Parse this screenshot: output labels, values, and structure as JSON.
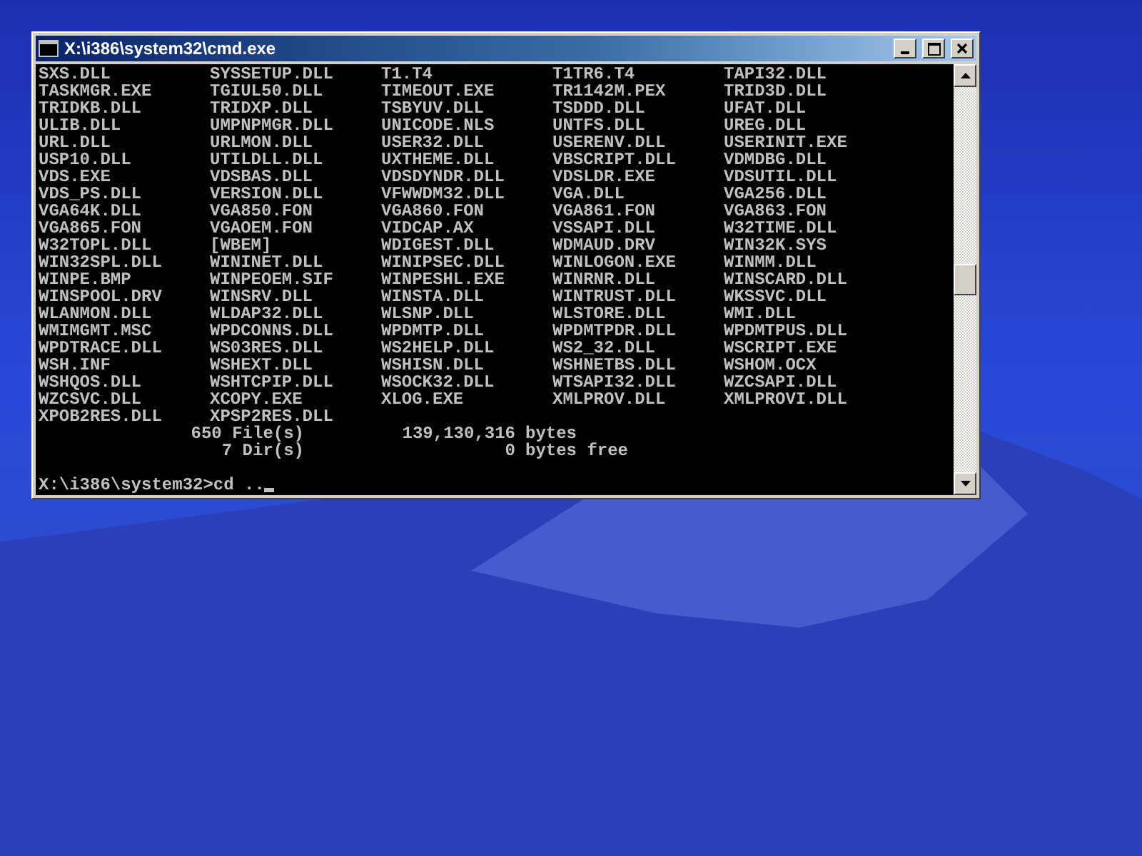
{
  "window": {
    "title": "X:\\i386\\system32\\cmd.exe"
  },
  "console": {
    "rows": [
      [
        "SXS.DLL",
        "SYSSETUP.DLL",
        "T1.T4",
        "T1TR6.T4",
        "TAPI32.DLL"
      ],
      [
        "TASKMGR.EXE",
        "TGIUL50.DLL",
        "TIMEOUT.EXE",
        "TR1142M.PEX",
        "TRID3D.DLL"
      ],
      [
        "TRIDKB.DLL",
        "TRIDXP.DLL",
        "TSBYUV.DLL",
        "TSDDD.DLL",
        "UFAT.DLL"
      ],
      [
        "ULIB.DLL",
        "UMPNPMGR.DLL",
        "UNICODE.NLS",
        "UNTFS.DLL",
        "UREG.DLL"
      ],
      [
        "URL.DLL",
        "URLMON.DLL",
        "USER32.DLL",
        "USERENV.DLL",
        "USERINIT.EXE"
      ],
      [
        "USP10.DLL",
        "UTILDLL.DLL",
        "UXTHEME.DLL",
        "VBSCRIPT.DLL",
        "VDMDBG.DLL"
      ],
      [
        "VDS.EXE",
        "VDSBAS.DLL",
        "VDSDYNDR.DLL",
        "VDSLDR.EXE",
        "VDSUTIL.DLL"
      ],
      [
        "VDS_PS.DLL",
        "VERSION.DLL",
        "VFWWDM32.DLL",
        "VGA.DLL",
        "VGA256.DLL"
      ],
      [
        "VGA64K.DLL",
        "VGA850.FON",
        "VGA860.FON",
        "VGA861.FON",
        "VGA863.FON"
      ],
      [
        "VGA865.FON",
        "VGAOEM.FON",
        "VIDCAP.AX",
        "VSSAPI.DLL",
        "W32TIME.DLL"
      ],
      [
        "W32TOPL.DLL",
        "[WBEM]",
        "WDIGEST.DLL",
        "WDMAUD.DRV",
        "WIN32K.SYS"
      ],
      [
        "WIN32SPL.DLL",
        "WININET.DLL",
        "WINIPSEC.DLL",
        "WINLOGON.EXE",
        "WINMM.DLL"
      ],
      [
        "WINPE.BMP",
        "WINPEOEM.SIF",
        "WINPESHL.EXE",
        "WINRNR.DLL",
        "WINSCARD.DLL"
      ],
      [
        "WINSPOOL.DRV",
        "WINSRV.DLL",
        "WINSTA.DLL",
        "WINTRUST.DLL",
        "WKSSVC.DLL"
      ],
      [
        "WLANMON.DLL",
        "WLDAP32.DLL",
        "WLSNP.DLL",
        "WLSTORE.DLL",
        "WMI.DLL"
      ],
      [
        "WMIMGMT.MSC",
        "WPDCONNS.DLL",
        "WPDMTP.DLL",
        "WPDMTPDR.DLL",
        "WPDMTPUS.DLL"
      ],
      [
        "WPDTRACE.DLL",
        "WS03RES.DLL",
        "WS2HELP.DLL",
        "WS2_32.DLL",
        "WSCRIPT.EXE"
      ],
      [
        "WSH.INF",
        "WSHEXT.DLL",
        "WSHISN.DLL",
        "WSHNETBS.DLL",
        "WSHOM.OCX"
      ],
      [
        "WSHQOS.DLL",
        "WSHTCPIP.DLL",
        "WSOCK32.DLL",
        "WTSAPI32.DLL",
        "WZCSAPI.DLL"
      ],
      [
        "WZCSVC.DLL",
        "XCOPY.EXE",
        "XLOG.EXE",
        "XMLPROV.DLL",
        "XMLPROVI.DLL"
      ],
      [
        "XPOB2RES.DLL",
        "XPSP2RES.DLL"
      ]
    ],
    "summary": [
      {
        "count": "650 File(s)",
        "number": "139,130,316",
        "unit": "bytes"
      },
      {
        "count": "7 Dir(s)",
        "number": "0",
        "unit": "bytes free"
      }
    ],
    "prompt": "X:\\i386\\system32>cd .."
  }
}
